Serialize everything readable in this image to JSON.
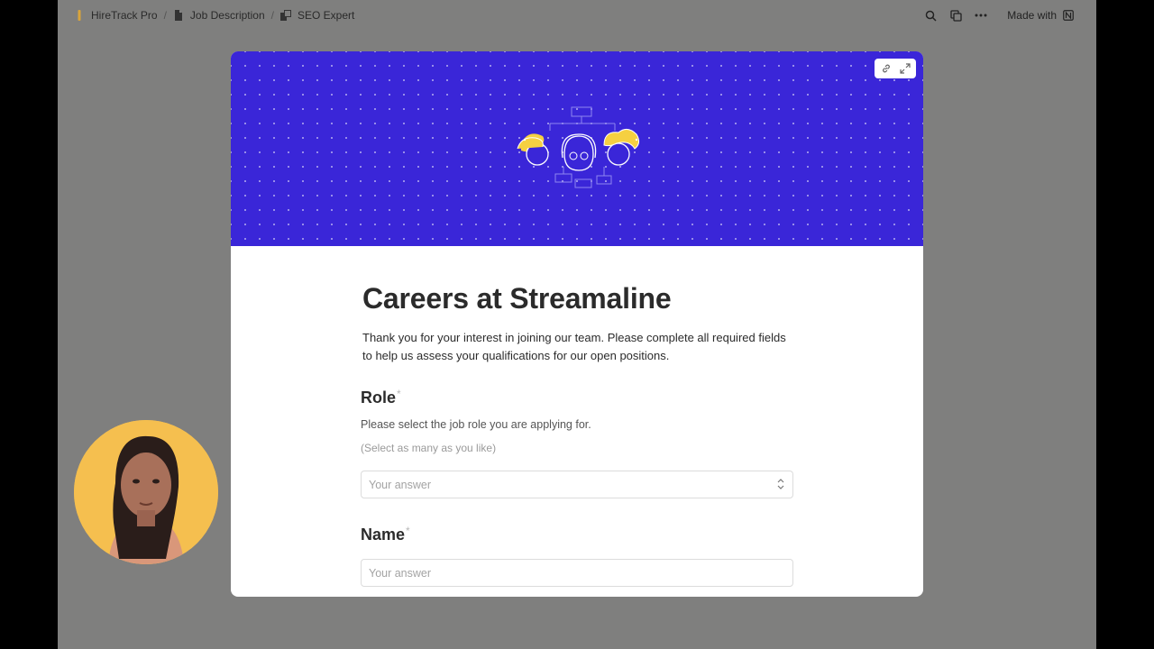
{
  "breadcrumb": {
    "items": [
      {
        "label": "HireTrack Pro",
        "icon": "warning-bar-icon"
      },
      {
        "label": "Job Description",
        "icon": "document-icon"
      },
      {
        "label": "SEO Expert",
        "icon": "page-stack-icon"
      }
    ],
    "separator": "/"
  },
  "topbar": {
    "made_with_label": "Made with",
    "icons": [
      "search-icon",
      "duplicate-icon",
      "more-icon",
      "notion-logo-icon"
    ]
  },
  "cover": {
    "background_color": "#3a26d8",
    "accent_color": "#f5d041",
    "actions": [
      "link-icon",
      "expand-icon"
    ]
  },
  "form": {
    "title": "Careers at Streamaline",
    "intro": "Thank you for your interest in joining our team. Please complete all required fields to help us assess your qualifications for our open positions.",
    "questions": [
      {
        "label": "Role",
        "required_mark": "*",
        "description": "Please select the job role you are applying for.",
        "hint": "(Select as many as you like)",
        "placeholder": "Your answer",
        "type": "select"
      },
      {
        "label": "Name",
        "required_mark": "*",
        "placeholder": "Your answer",
        "type": "text"
      }
    ]
  },
  "presenter": {
    "background_color": "#f5bf4f"
  }
}
